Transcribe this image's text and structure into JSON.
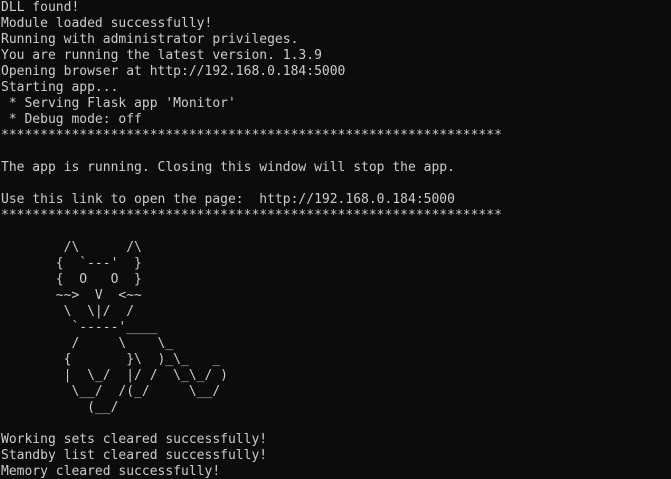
{
  "console": {
    "lines": [
      "DLL found!",
      "Module loaded successfully!",
      "Running with administrator privileges.",
      "You are running the latest version. 1.3.9",
      "Opening browser at http://192.168.0.184:5000",
      "Starting app...",
      " * Serving Flask app 'Monitor'",
      " * Debug mode: off",
      "****************************************************************",
      "",
      "The app is running. Closing this window will stop the app.",
      "",
      "Use this link to open the page:  http://192.168.0.184:5000",
      "****************************************************************",
      "",
      "        /\\      /\\",
      "       {  `---'  }",
      "       {  O   O  }",
      "       ~~>  V  <~~",
      "        \\  \\|/  /",
      "         `-----'____",
      "         /     \\    \\_",
      "        {       }\\  )_\\_   _",
      "        |  \\_/  |/ /  \\_\\_/ )",
      "         \\__/  /(_/     \\__/",
      "           (__/",
      "",
      "Working sets cleared successfully!",
      "Standby list cleared successfully!",
      "Memory cleared successfully!"
    ]
  }
}
